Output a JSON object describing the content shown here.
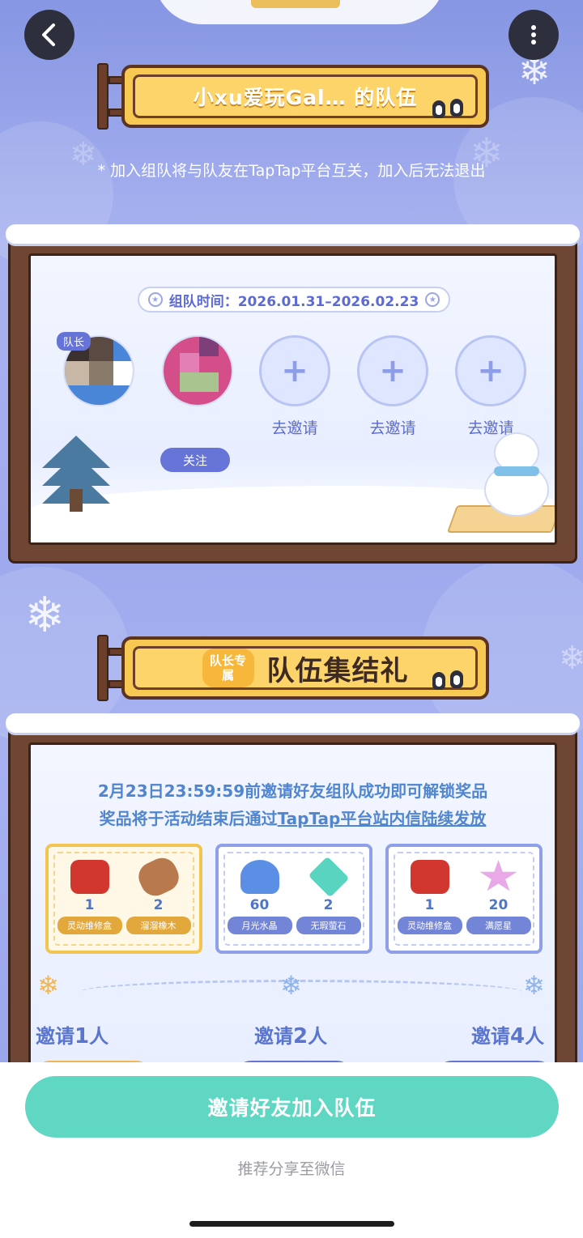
{
  "header": {
    "back_icon": "chevron-left-icon",
    "more_icon": "more-vertical-icon"
  },
  "team_sign": {
    "title": "小xu爱玩Gal… 的队伍"
  },
  "notice": "* 加入组队将与队友在TapTap平台互关，加入后无法退出",
  "team_panel": {
    "time_label": "组队时间：2026.01.31–2026.02.23",
    "leader_tag": "队长",
    "follow_label": "关注",
    "invite_slots": [
      {
        "label": "去邀请"
      },
      {
        "label": "去邀请"
      },
      {
        "label": "去邀请"
      }
    ]
  },
  "rewards_sign": {
    "badge": "队长专属",
    "title": "队伍集结礼"
  },
  "rewards_panel": {
    "line1": "2月23日23:59:59前邀请好友组队成功即可解锁奖品",
    "line2_prefix": "奖品将于活动结束后通过",
    "line2_link": "TapTap平台站内信陆续发放",
    "cards": [
      {
        "items": [
          {
            "icon": "toolbox-icon",
            "qty": "1",
            "name": "灵动维修盒"
          },
          {
            "icon": "wood-log-icon",
            "qty": "2",
            "name": "溜溜橡木"
          }
        ]
      },
      {
        "items": [
          {
            "icon": "crystal-heart-icon",
            "qty": "60",
            "name": "月光水晶"
          },
          {
            "icon": "gem-icon",
            "qty": "2",
            "name": "无瑕萤石"
          }
        ]
      },
      {
        "items": [
          {
            "icon": "toolbox-icon",
            "qty": "1",
            "name": "灵动维修盒"
          },
          {
            "icon": "star-icon",
            "qty": "20",
            "name": "满愿星"
          }
        ]
      }
    ],
    "tiers": [
      {
        "prefix": "邀请",
        "count": "1",
        "suffix": "人"
      },
      {
        "prefix": "邀请",
        "count": "2",
        "suffix": "人"
      },
      {
        "prefix": "邀请",
        "count": "4",
        "suffix": "人"
      }
    ]
  },
  "bottom": {
    "invite_button": "邀请好友加入队伍",
    "share_link": "推荐分享至微信"
  },
  "colors": {
    "accent": "#6674d8",
    "primary_button": "#5fd7c3",
    "sign_gold": "#f7c952",
    "wood": "#6f4533"
  }
}
